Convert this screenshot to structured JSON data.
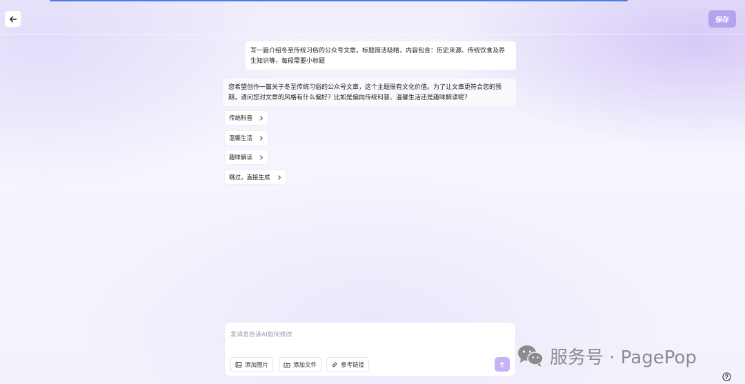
{
  "toolbar": {
    "save_label": "保存"
  },
  "conversation": {
    "user_message": "写一篇介绍冬至传统习俗的公众号文章，标题简洁吸睛，内容包含：历史来源、传统饮食及养生知识等，每段需要小标题",
    "ai_message": "您希望创作一篇关于冬至传统习俗的公众号文章，这个主题很有文化价值。为了让文章更符合您的预期，请问您对文章的风格有什么偏好？比如是偏向传统科普、温馨生活还是趣味解读呢？",
    "options": [
      "传统科普",
      "温馨生活",
      "趣味解读",
      "跳过，直接生成"
    ]
  },
  "composer": {
    "placeholder": "发消息告诉AI如何修改",
    "value": "",
    "add_image_label": "添加图片",
    "add_file_label": "添加文件",
    "reference_link_label": "参考链接"
  },
  "watermark": {
    "text": "服务号 · PagePop"
  },
  "colors": {
    "accent": "#b7a2ef",
    "send": "#c7b3f3",
    "strip": "#4b7be8"
  },
  "icons": {
    "back": "arrow-left-icon",
    "option": "chevron-right-icon",
    "image": "image-icon",
    "file": "folder-upload-icon",
    "link": "link-icon",
    "send": "arrow-up-icon",
    "wechat": "wechat-icon",
    "help": "help-icon"
  }
}
